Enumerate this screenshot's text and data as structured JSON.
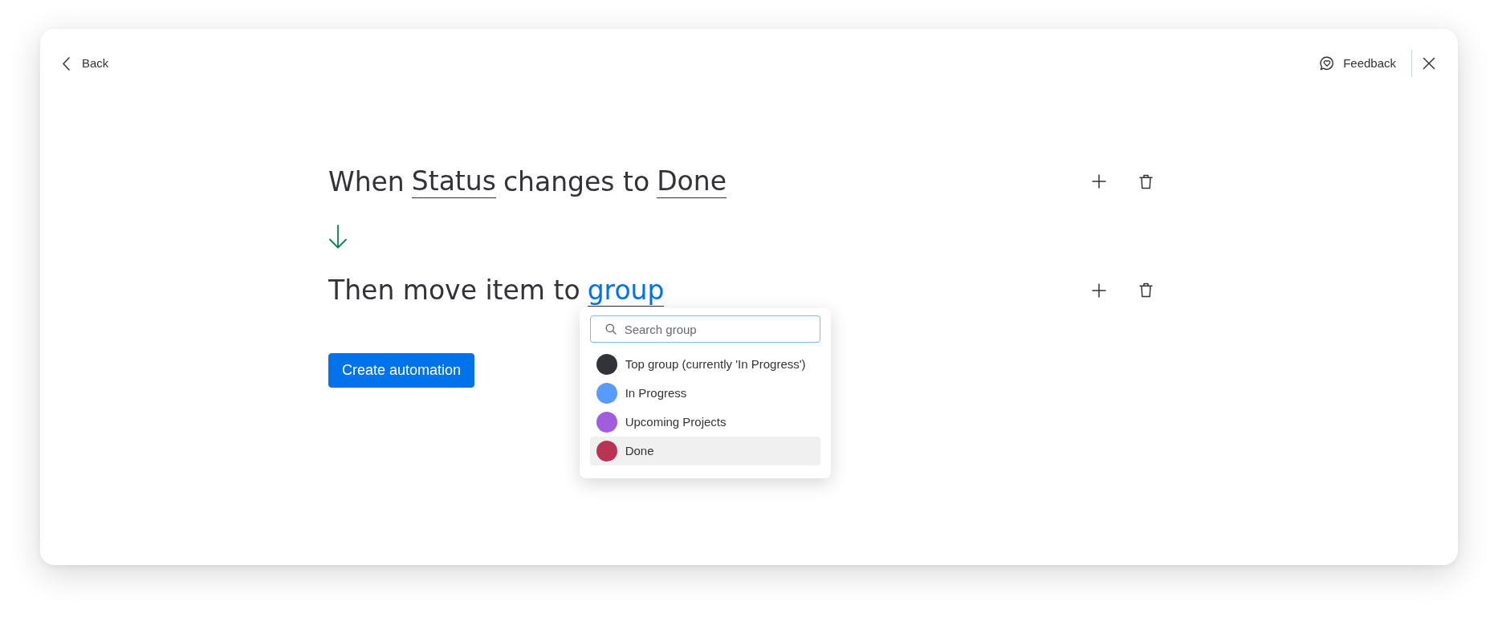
{
  "header": {
    "back": "Back",
    "feedback": "Feedback"
  },
  "steps": [
    {
      "parts": [
        {
          "kind": "text",
          "text": "When"
        },
        {
          "kind": "field",
          "text": "Status",
          "open": false
        },
        {
          "kind": "text",
          "text": "changes to"
        },
        {
          "kind": "field",
          "text": "Done",
          "open": false
        }
      ]
    },
    {
      "parts": [
        {
          "kind": "text",
          "text": "Then move item to"
        },
        {
          "kind": "field",
          "text": "group",
          "open": true
        }
      ]
    }
  ],
  "create_button": "Create automation",
  "dropdown": {
    "search": {
      "placeholder": "Search group"
    },
    "options": [
      {
        "label": "Top group (currently 'In Progress')",
        "color": "#323338",
        "selected": false
      },
      {
        "label": "In Progress",
        "color": "#579bfc",
        "selected": false
      },
      {
        "label": "Upcoming Projects",
        "color": "#a25ddc",
        "selected": false
      },
      {
        "label": "Done",
        "color": "#bb3354",
        "selected": true
      }
    ]
  }
}
